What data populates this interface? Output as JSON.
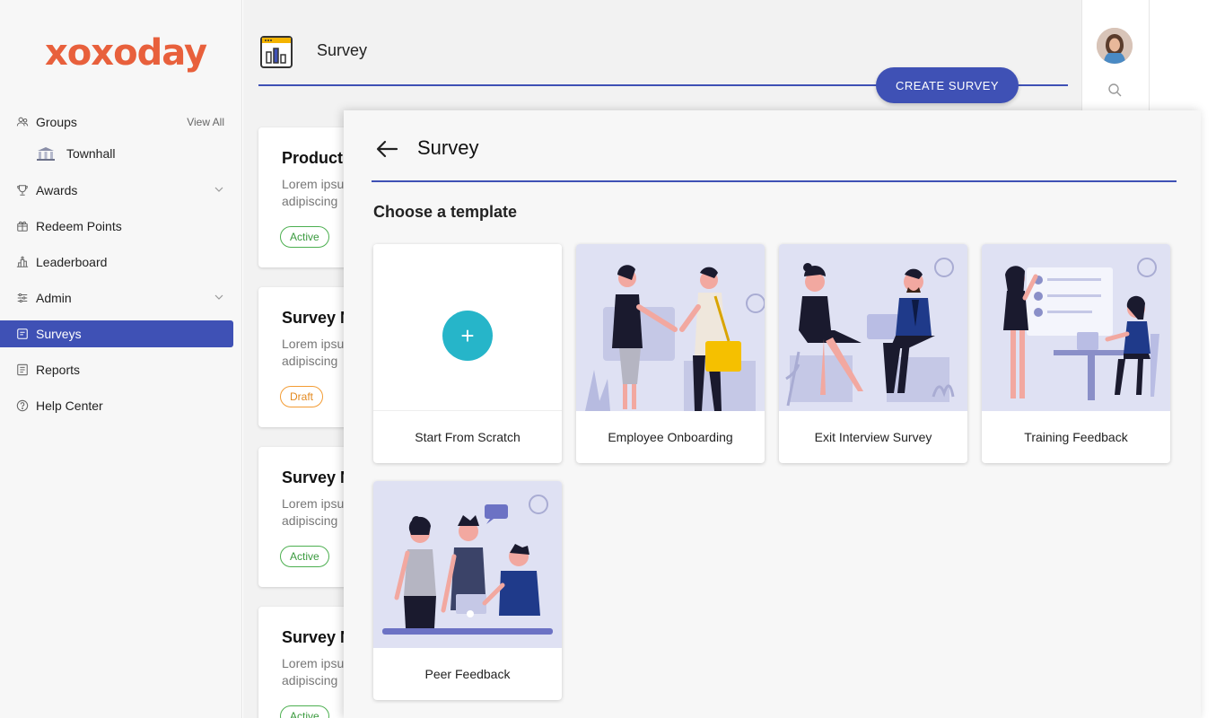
{
  "brand": {
    "logo_text": "xoxoday",
    "color": "#e8603c"
  },
  "sidebar": {
    "groups_label": "Groups",
    "view_all": "View All",
    "group_items": [
      "Townhall"
    ],
    "items": [
      {
        "label": "Awards",
        "icon": "trophy-icon"
      },
      {
        "label": "Redeem Points",
        "icon": "gift-icon"
      },
      {
        "label": "Leaderboard",
        "icon": "leaderboard-icon"
      },
      {
        "label": "Admin",
        "icon": "sliders-icon"
      },
      {
        "label": "Surveys",
        "icon": "survey-icon",
        "active": true
      },
      {
        "label": "Reports",
        "icon": "reports-icon"
      },
      {
        "label": "Help Center",
        "icon": "help-icon"
      }
    ]
  },
  "header": {
    "title": "Survey",
    "create_button": "CREATE SURVEY",
    "accent": "#3f51b5"
  },
  "survey_cards": [
    {
      "title": "Product",
      "desc1": "Lorem ipsu",
      "desc2": "adipiscing",
      "status": "Active"
    },
    {
      "title": "Survey N",
      "desc1": "Lorem ipsu",
      "desc2": "adipiscing",
      "status": "Draft"
    },
    {
      "title": "Survey N",
      "desc1": "Lorem ipsu",
      "desc2": "adipiscing",
      "status": "Active"
    },
    {
      "title": "Survey N",
      "desc1": "Lorem ipsu",
      "desc2": "adipiscing",
      "status": "Active"
    }
  ],
  "panel": {
    "title": "Survey",
    "subtitle": "Choose a template",
    "templates": [
      {
        "label": "Start From Scratch"
      },
      {
        "label": "Employee Onboarding"
      },
      {
        "label": "Exit Interview Survey"
      },
      {
        "label": "Training Feedback"
      },
      {
        "label": "Peer Feedback"
      }
    ]
  }
}
